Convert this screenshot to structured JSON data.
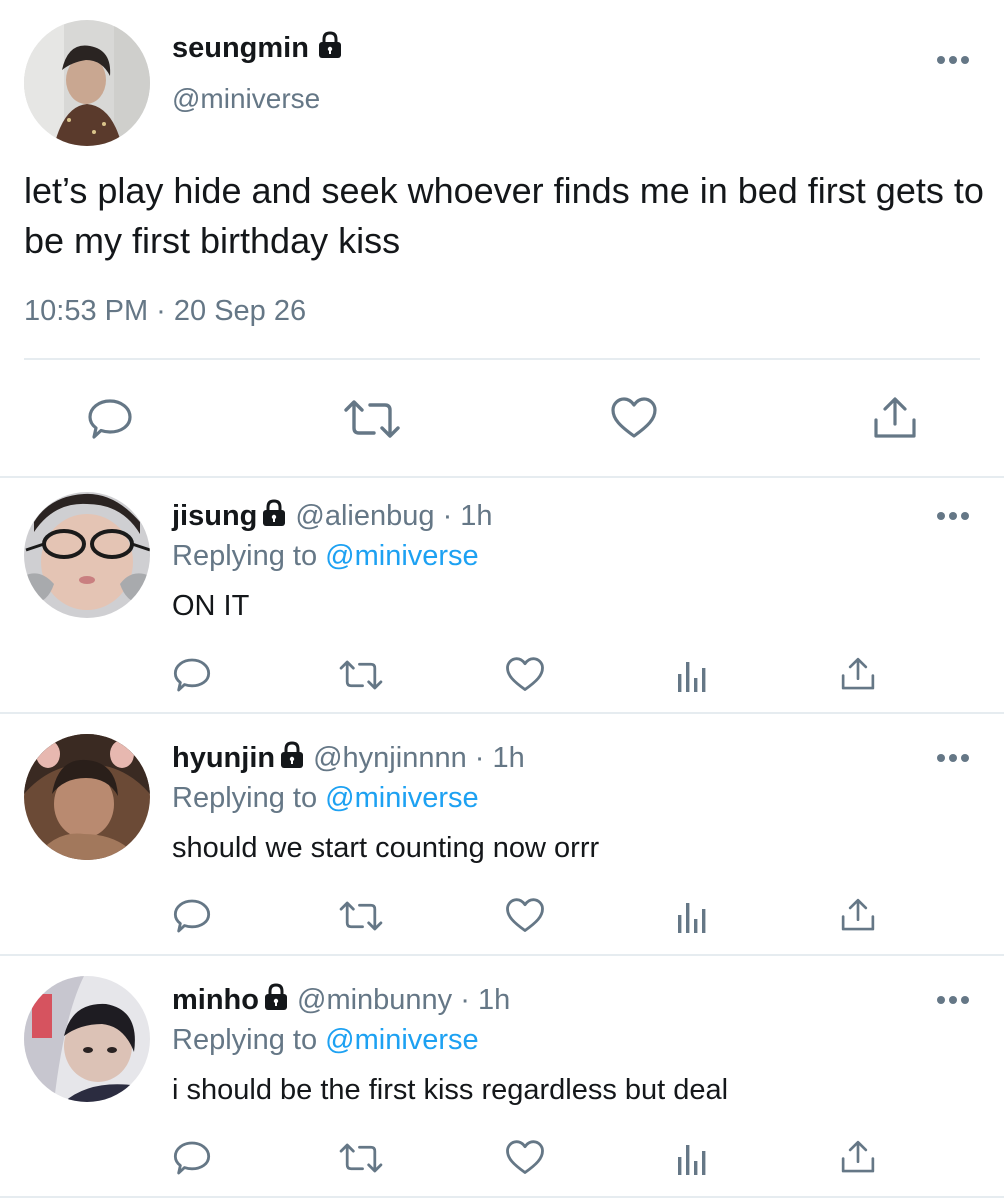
{
  "main_tweet": {
    "display_name": "seungmin",
    "handle": "@miniverse",
    "text": "let’s play hide and seek whoever finds me in bed first gets to be my first birthday kiss",
    "timestamp": "10:53 PM · 20 Sep 26",
    "icons": [
      "lock-icon",
      "more-icon",
      "reply-icon",
      "retweet-icon",
      "like-icon",
      "share-icon"
    ]
  },
  "replies": [
    {
      "display_name": "jisung",
      "handle": "@alienbug",
      "time": "· 1h",
      "replying_prefix": "Replying to",
      "replying_to": "@miniverse",
      "text": "ON IT"
    },
    {
      "display_name": "hyunjin",
      "handle": "@hynjinnnn",
      "time": "· 1h",
      "replying_prefix": "Replying to",
      "replying_to": "@miniverse",
      "text": "should we start counting now orrr"
    },
    {
      "display_name": "minho",
      "handle": "@minbunny",
      "time": "· 1h",
      "replying_prefix": "Replying to",
      "replying_to": "@miniverse",
      "text": "i should be the first kiss regardless but deal"
    }
  ],
  "colors": {
    "text": "#14171a",
    "muted": "#657786",
    "link": "#1da1f2",
    "divider": "#e6ecf0"
  }
}
